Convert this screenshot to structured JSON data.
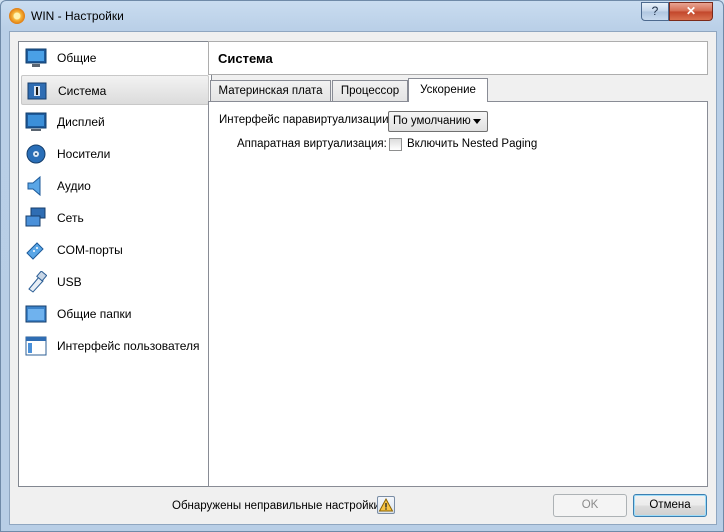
{
  "window": {
    "title": "WIN - Настройки",
    "help_label": "?",
    "close_label": "✕"
  },
  "sidebar": {
    "items": [
      {
        "label": "Общие",
        "icon": "general-icon"
      },
      {
        "label": "Система",
        "icon": "system-icon",
        "selected": true
      },
      {
        "label": "Дисплей",
        "icon": "display-icon"
      },
      {
        "label": "Носители",
        "icon": "storage-icon"
      },
      {
        "label": "Аудио",
        "icon": "audio-icon"
      },
      {
        "label": "Сеть",
        "icon": "network-icon"
      },
      {
        "label": "COM-порты",
        "icon": "serial-ports-icon"
      },
      {
        "label": "USB",
        "icon": "usb-icon"
      },
      {
        "label": "Общие папки",
        "icon": "shared-folders-icon"
      },
      {
        "label": "Интерфейс пользователя",
        "icon": "user-interface-icon"
      }
    ]
  },
  "main": {
    "section_title": "Система",
    "tabs": [
      {
        "label": "Материнская плата",
        "active": false
      },
      {
        "label": "Процессор",
        "active": false
      },
      {
        "label": "Ускорение",
        "active": true
      }
    ],
    "acceleration": {
      "paravirt_label": "Интерфейс паравиртуализации:",
      "paravirt_value": "По умолчанию",
      "hwvirt_label": "Аппаратная виртуализация:",
      "nested_paging_label": "Включить Nested Paging",
      "nested_paging_checked": false
    }
  },
  "footer": {
    "warning_text": "Обнаружены неправильные настройки",
    "ok_label": "OK",
    "cancel_label": "Отмена"
  },
  "colors": {
    "window_frame": "#b9cfe7",
    "accent_blue": "#3c7fb1"
  }
}
